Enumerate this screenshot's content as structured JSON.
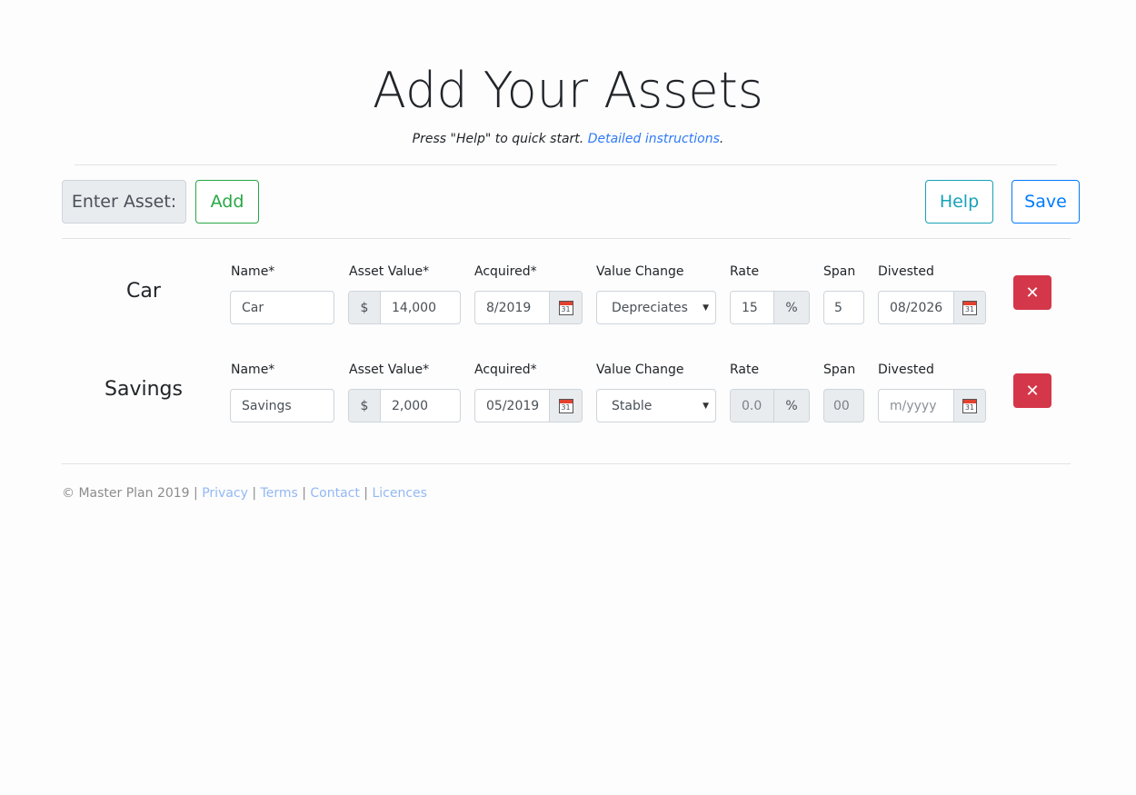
{
  "header": {
    "title": "Add Your Assets",
    "subtitle": "Press \"Help\" to quick start.",
    "instructions_link": "Detailed instructions",
    "period": "."
  },
  "toolbar": {
    "enter_label": "Enter Asset:",
    "add": "Add",
    "help": "Help",
    "save": "Save"
  },
  "labels": {
    "name": "Name*",
    "asset_value": "Asset Value*",
    "acquired": "Acquired*",
    "value_change": "Value Change",
    "rate": "Rate",
    "span": "Span",
    "divested": "Divested",
    "currency": "$",
    "percent": "%"
  },
  "assets": [
    {
      "title": "Car",
      "name": "Car",
      "value": "14,000",
      "acquired": "8/2019",
      "value_change": "Depreciates",
      "rate": "15",
      "span": "5",
      "divested": "08/2026",
      "divested_placeholder": "m/yyyy",
      "disabled": false
    },
    {
      "title": "Savings",
      "name": "Savings",
      "value": "2,000",
      "acquired": "05/2019",
      "value_change": "Stable",
      "rate": "0.0",
      "span": "00",
      "divested": "",
      "divested_placeholder": "m/yyyy",
      "disabled": true
    }
  ],
  "icons": {
    "calendar": "calendar-icon",
    "delete": "close-icon",
    "dropdown": "caret-down-icon"
  },
  "calendar_day": "31",
  "delete_glyph": "✕",
  "footer": {
    "copyright": "© Master Plan 2019",
    "links": [
      "Privacy",
      "Terms",
      "Contact",
      "Licences"
    ]
  },
  "colors": {
    "add": "#28a745",
    "help": "#17a2b8",
    "save": "#007bff",
    "delete": "#d4374a",
    "link": "#2f7bf5"
  }
}
